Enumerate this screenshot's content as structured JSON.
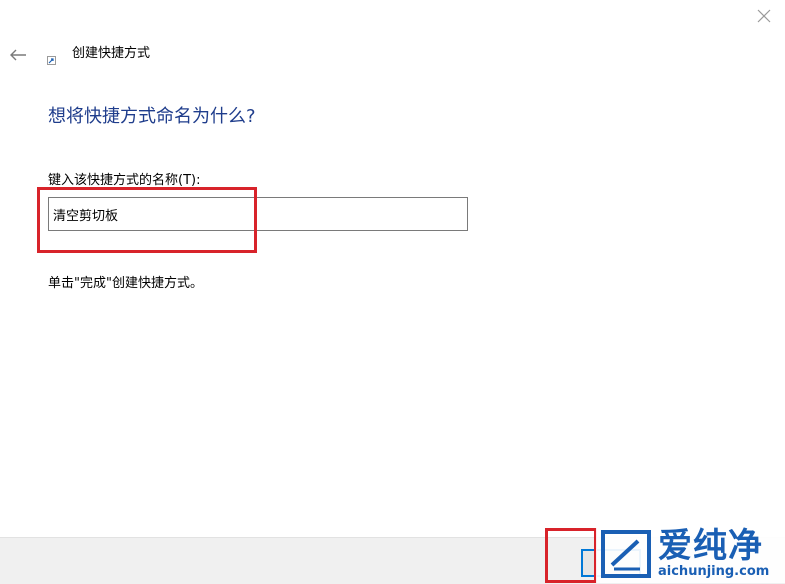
{
  "window": {
    "title": "创建快捷方式",
    "close_icon": "close-icon",
    "back_icon": "arrow-left-icon",
    "app_icon": "shortcut-icon"
  },
  "wizard": {
    "heading": "想将快捷方式命名为什么?",
    "name_label": "键入该快捷方式的名称(T):",
    "name_value": "清空剪切板",
    "hint": "单击\"完成\"创建快捷方式。"
  },
  "footer": {
    "finish_button_label": ""
  },
  "watermark": {
    "brand": "爱纯净",
    "url": "aichunjing.com"
  },
  "colors": {
    "heading": "#1f3d8c",
    "highlight": "#d8232a",
    "focus_border": "#0078d7",
    "brand": "#1a5fb4"
  }
}
